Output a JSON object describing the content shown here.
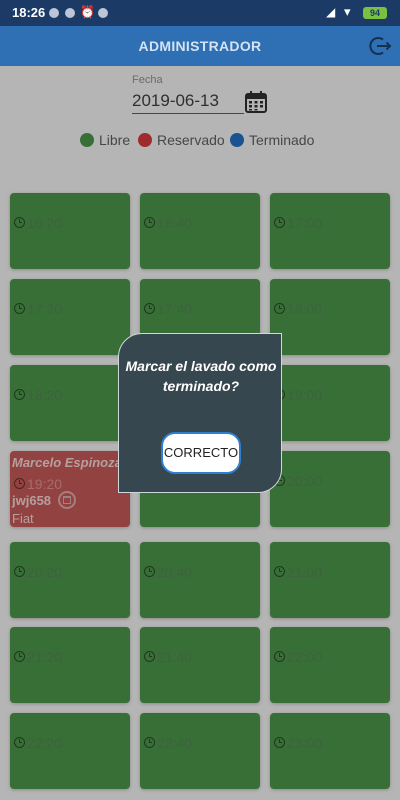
{
  "status_bar": {
    "time": "18:26",
    "battery": "94"
  },
  "app_bar": {
    "title": "ADMINISTRADOR"
  },
  "date": {
    "label": "Fecha",
    "value": "2019-06-13"
  },
  "legend": [
    {
      "label": "Libre",
      "color": "#3e8f3e"
    },
    {
      "label": "Reservado",
      "color": "#d32f2f"
    },
    {
      "label": "Terminado",
      "color": "#1565c0"
    }
  ],
  "slots": [
    {
      "time": ""
    },
    {
      "time": ""
    },
    {
      "time": ""
    },
    {
      "time": "16:20"
    },
    {
      "time": "16:40"
    },
    {
      "time": "17:00"
    },
    {
      "time": "17:20"
    },
    {
      "time": "17:40"
    },
    {
      "time": "18:00"
    },
    {
      "time": "18:20"
    },
    {
      "time": "18:40"
    },
    {
      "time": "19:00"
    },
    {
      "time": "19:20",
      "reserved": true,
      "name": "Marcelo Espinoza",
      "plate": "jwj658",
      "brand": "Fiat"
    },
    {
      "time": "19:40"
    },
    {
      "time": "20:00"
    },
    {
      "time": "20:20"
    },
    {
      "time": "20:40"
    },
    {
      "time": "21:00"
    },
    {
      "time": "21:20"
    },
    {
      "time": "21:40"
    },
    {
      "time": "22:00"
    },
    {
      "time": "22:20"
    },
    {
      "time": "22:40"
    },
    {
      "time": "23:00"
    }
  ],
  "dialog": {
    "message": "Marcar el lavado como terminado?",
    "button": "CORRECTO"
  },
  "colors": {
    "free": "#3e8f3e",
    "reserved": "#c0504d",
    "app_bar": "#2f6fb4",
    "dialog": "#37474f"
  }
}
